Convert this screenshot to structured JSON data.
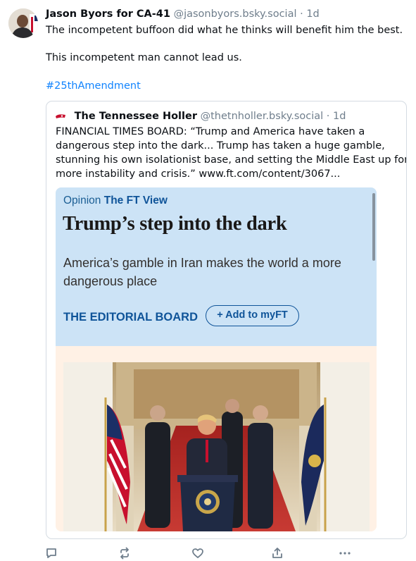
{
  "post": {
    "author_name": "Jason Byors for CA-41",
    "handle": "@jasonbyors.bsky.social",
    "separator": "·",
    "time": "1d",
    "text_line1": "The incompetent buffoon did what he thinks will benefit him the best.",
    "text_line2": "This incompetent man cannot lead us.",
    "hashtag": "#25thAmendment"
  },
  "quote": {
    "author_name": "The Tennessee Holler",
    "handle": "@thetnholler.bsky.social",
    "separator": "·",
    "time": "1d",
    "lines": [
      "FINANCIAL TIMES BOARD: “Trump and America have taken a",
      "dangerous step into the dark... Trump has taken a huge gamble,",
      "stunning his own isolationist base, and setting the Middle East up for",
      "more instability and crisis.” www.ft.com/content/3067..."
    ]
  },
  "embed": {
    "kicker_prefix": "Opinion",
    "kicker_section": "The FT View",
    "headline": "Trump’s step into the dark",
    "standfirst": "America’s gamble in Iran makes the world a more dangerous place",
    "author": "THE EDITORIAL BOARD",
    "add_button": "+ Add to myFT"
  },
  "actions": [
    "reply-icon",
    "repost-icon",
    "like-icon",
    "share-icon",
    "more-icon"
  ],
  "colors": {
    "hashtag": "#1083fe",
    "ft_blue_panel": "#cce3f6",
    "ft_pink": "#fff1e5",
    "ft_brand_blue": "#0f5499",
    "muted": "#6f7e8c"
  }
}
